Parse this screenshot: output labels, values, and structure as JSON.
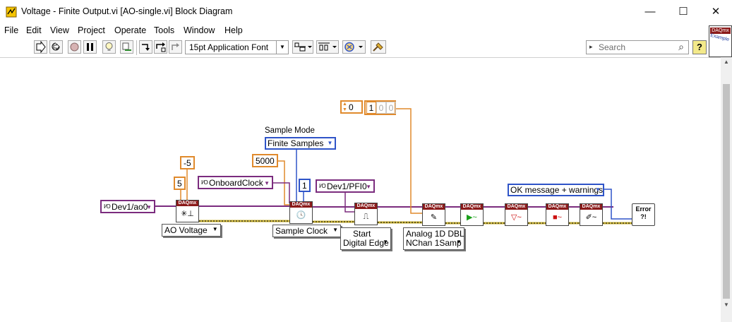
{
  "window": {
    "title": "Voltage - Finite Output.vi [AO-single.vi] Block Diagram",
    "minimize": "—",
    "maximize": "☐",
    "close": "✕"
  },
  "menu": [
    "File",
    "Edit",
    "View",
    "Project",
    "Operate",
    "Tools",
    "Window",
    "Help"
  ],
  "toolbar": {
    "font_label": "15pt Application Font",
    "search_placeholder": "Search",
    "help_label": "?",
    "icons": [
      "run-arrow-icon",
      "run-continuously-icon",
      "abort-icon",
      "pause-icon",
      "highlight-execution-icon",
      "retain-wire-values-icon",
      "step-into-icon",
      "step-over-icon",
      "step-out-icon",
      "align-objects-icon",
      "distribute-objects-icon",
      "reorder-icon",
      "clean-up-diagram-icon"
    ]
  },
  "thumbnail": {
    "header": "DAQmx",
    "body": "Example"
  },
  "diagram": {
    "channel_constant": "Dev1/ao0",
    "min_value": "-5",
    "max_value": "5",
    "onboard_clock": "OnboardClock",
    "rate_constant": "5000",
    "samples_constant": "1",
    "sample_mode_label": "Sample Mode",
    "sample_mode_value": "Finite Samples",
    "trigger_source": "Dev1/PFI0",
    "array_index": "0",
    "array_values": [
      "1",
      "0",
      "0"
    ],
    "error_mode": "OK message + warnings",
    "daqmx_header": "DAQmx",
    "ao_voltage": "AO Voltage",
    "sample_clock": "Sample Clock",
    "start_trigger_line1": "Start",
    "start_trigger_line2": "Digital Edge",
    "write_line1": "Analog 1D DBL",
    "write_line2": "NChan 1Samp",
    "error_icon_text": "Error\n?!"
  },
  "colors": {
    "wire_orange": "#e08a2c",
    "wire_blue": "#2f54c8",
    "wire_purple": "#7b2c7e",
    "wire_error": "#c9b236",
    "daqmx_header": "#8b1a1a"
  }
}
